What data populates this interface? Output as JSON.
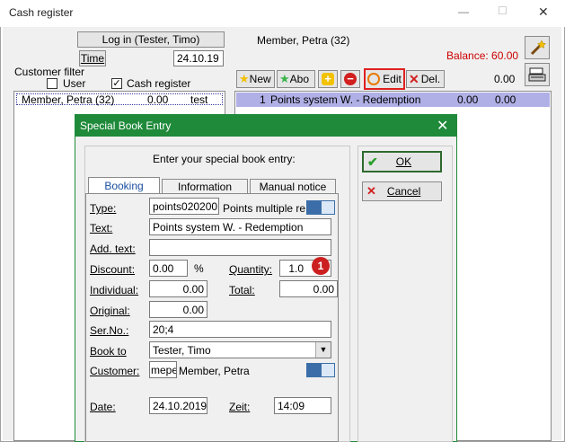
{
  "window": {
    "title": "Cash register",
    "min_label": "—",
    "max_label": "☐",
    "close_label": "✕"
  },
  "topbar": {
    "login_button": "Log in (Tester, Timo)",
    "time_button": "Time",
    "date": "24.10.19",
    "member_name": "Member, Petra (32)",
    "balance": "Balance: 60.00"
  },
  "customer_filter": {
    "title": "Customer filter",
    "user_label": "User",
    "cash_register_label": "Cash register",
    "user_checked": false,
    "cash_register_checked": true
  },
  "customer_list": [
    {
      "name": "Member, Petra (32)",
      "amount": "0.00",
      "note": "test"
    }
  ],
  "toolbar": {
    "new": "New",
    "abo": "Abo",
    "edit": "Edit",
    "del": "Del.",
    "total": "0.00"
  },
  "entries": [
    {
      "qty": "1",
      "text": "Points system W. - Redemption",
      "price": "0.00",
      "total": "0.00"
    }
  ],
  "dialog": {
    "title": "Special Book Entry",
    "prompt": "Enter your special book entry:",
    "ok": "OK",
    "cancel": "Cancel",
    "tabs": [
      "Booking",
      "Information",
      "Manual notice"
    ],
    "labels": {
      "type": "Type:",
      "text": "Text:",
      "add_text": "Add. text:",
      "discount": "Discount:",
      "percent": "%",
      "quantity": "Quantity:",
      "individual": "Individual:",
      "total": "Total:",
      "original": "Original:",
      "serno": "Ser.No.:",
      "book_to": "Book to",
      "customer": "Customer:",
      "date": "Date:",
      "zeit": "Zeit:"
    },
    "fields": {
      "type_code": "points020200",
      "type_desc": "Points multiple rede",
      "text": "Points system W. - Redemption",
      "add_text": "",
      "discount": "0.00",
      "quantity": "1.0",
      "individual": "0.00",
      "total": "0.00",
      "original": "0.00",
      "serno": "20;4",
      "book_to": "Tester, Timo",
      "customer_code": "mepe",
      "customer_name": "Member, Petra",
      "date": "24.10.2019",
      "zeit": "14:09"
    },
    "badge": "1"
  },
  "colors": {
    "dialog_header": "#1f8a3a",
    "selection": "#b0b0e6",
    "balance": "#cc0000",
    "edit_border": "#e02020",
    "badge": "#cc1f1f"
  }
}
